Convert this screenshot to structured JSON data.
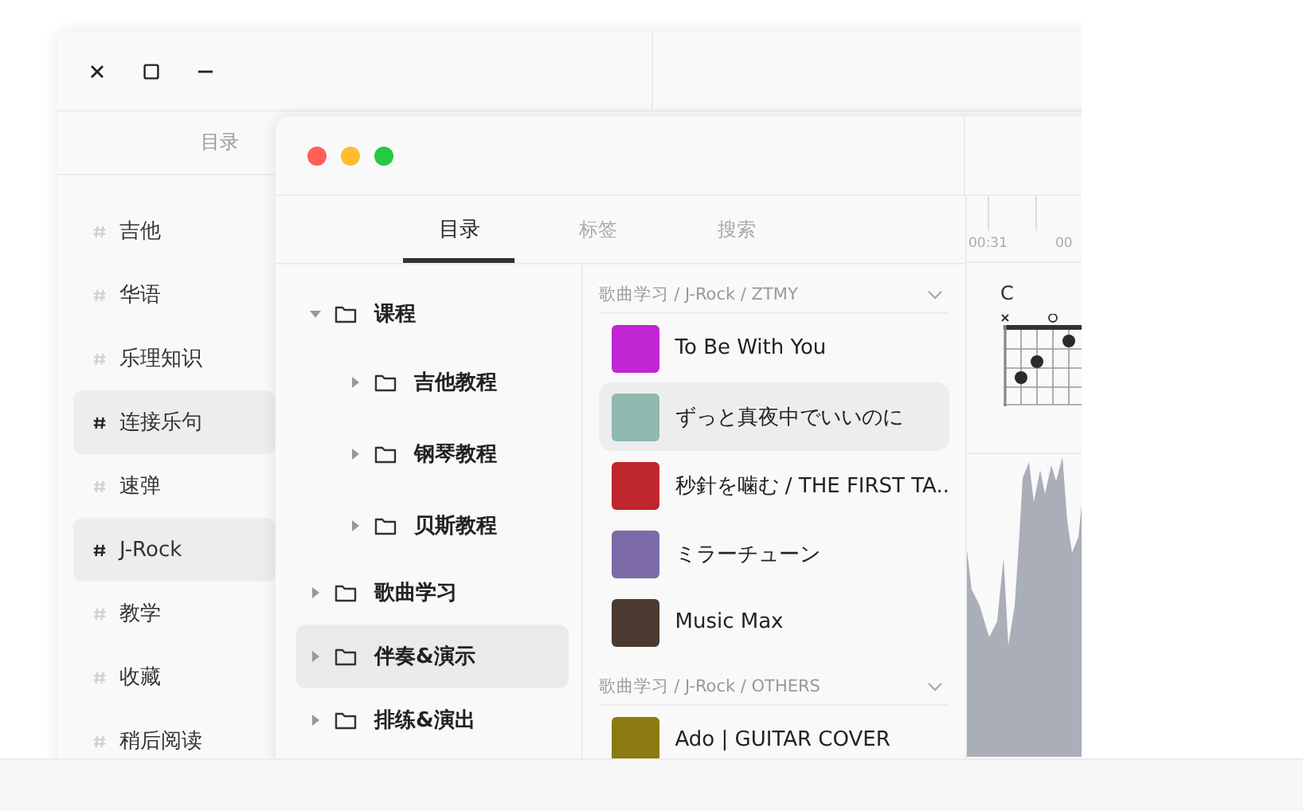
{
  "back_window": {
    "header": "目录",
    "sidebar": {
      "items": [
        {
          "label": "吉他",
          "selected": false
        },
        {
          "label": "华语",
          "selected": false
        },
        {
          "label": "乐理知识",
          "selected": false
        },
        {
          "label": "连接乐句",
          "selected": true
        },
        {
          "label": "速弹",
          "selected": false
        },
        {
          "label": "J-Rock",
          "selected": true
        },
        {
          "label": "教学",
          "selected": false
        },
        {
          "label": "收藏",
          "selected": false
        },
        {
          "label": "稍后阅读",
          "selected": false
        }
      ]
    }
  },
  "front_window": {
    "tabs": [
      {
        "label": "目录",
        "selected": true
      },
      {
        "label": "标签",
        "selected": false
      },
      {
        "label": "搜索",
        "selected": false
      }
    ],
    "tree": [
      {
        "label": "课程",
        "expanded": true,
        "selected": false,
        "children": [
          {
            "label": "吉他教程",
            "expanded": false,
            "selected": false
          },
          {
            "label": "钢琴教程",
            "expanded": false,
            "selected": false
          },
          {
            "label": "贝斯教程",
            "expanded": false,
            "selected": false
          }
        ]
      },
      {
        "label": "歌曲学习",
        "expanded": false,
        "selected": false
      },
      {
        "label": "伴奏&演示",
        "expanded": false,
        "selected": true
      },
      {
        "label": "排练&演出",
        "expanded": false,
        "selected": false
      }
    ],
    "song_groups": [
      {
        "path": "歌曲学习 / J-Rock / ZTMY",
        "songs": [
          {
            "title": "To Be With You",
            "selected": false,
            "color": "#c026d3"
          },
          {
            "title": "ずっと真夜中でいいのに",
            "selected": true,
            "color": "#8fb8b0"
          },
          {
            "title": "秒針を噛む / THE FIRST TA..",
            "selected": false,
            "color": "#c0262d"
          },
          {
            "title": "ミラーチューン",
            "selected": false,
            "color": "#7c6aa8"
          },
          {
            "title": "Music Max",
            "selected": false,
            "color": "#4a3a30"
          }
        ]
      },
      {
        "path": "歌曲学习 / J-Rock / OTHERS",
        "songs": [
          {
            "title": "Ado | GUITAR COVER",
            "selected": false,
            "color": "#8a7a10"
          }
        ]
      }
    ],
    "timeline": {
      "ticks": [
        "00:31",
        "00"
      ]
    },
    "chord": {
      "name": "C"
    }
  }
}
